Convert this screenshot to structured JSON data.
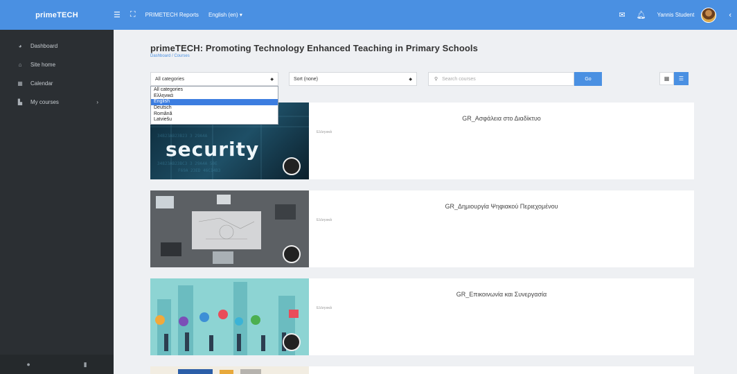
{
  "topbar": {
    "brand": "primeTECH",
    "reports_label": "PRIMETECH Reports",
    "language_label": "English (en) ▾",
    "user_name": "Yannis Student"
  },
  "sidebar": {
    "items": [
      {
        "label": "Dashboard",
        "icon": "dashboard-icon"
      },
      {
        "label": "Site home",
        "icon": "home-icon"
      },
      {
        "label": "Calendar",
        "icon": "calendar-icon"
      },
      {
        "label": "My courses",
        "icon": "courses-icon"
      }
    ]
  },
  "main": {
    "title": "primeTECH: Promoting Technology Enhanced Teaching in Primary Schools",
    "breadcrumb": "Dashboard / Courses"
  },
  "filters": {
    "category_selected": "All categories",
    "sort_selected": "Sort (none)",
    "search_placeholder": "Search courses",
    "go_label": "Go",
    "category_options": [
      "All categories",
      "Ελληνικά",
      "English",
      "Deutsch",
      "Română",
      "Latviešu"
    ],
    "highlighted_option": "English"
  },
  "courses": [
    {
      "title": "GR_Ασφάλεια στο Διαδίκτυο",
      "category": "Ελληνικά",
      "thumb_text": "security"
    },
    {
      "title": "GR_Δημιουργία Ψηφιακού Περιεχομένου",
      "category": "Ελληνικά"
    },
    {
      "title": "GR_Επικοινωνία και Συνεργασία",
      "category": "Ελληνικά"
    }
  ],
  "colors": {
    "accent": "#4a90e2",
    "sidebar_bg": "#2b2f33",
    "page_bg": "#eef0f3"
  }
}
